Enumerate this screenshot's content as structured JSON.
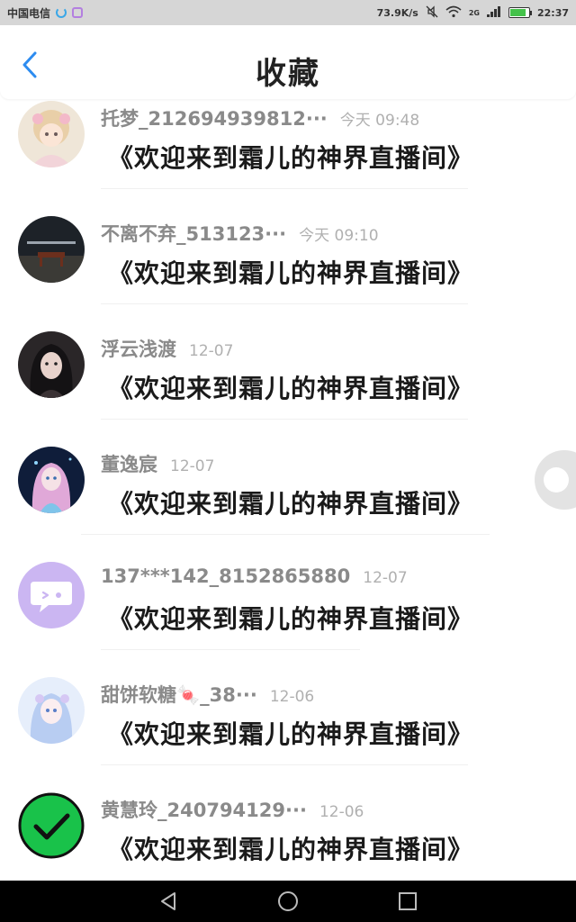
{
  "status_bar": {
    "carrier": "中国电信",
    "speed": "73.9K/s",
    "network": "2G",
    "time": "22:37",
    "battery_level": 0.85
  },
  "header": {
    "title": "收藏",
    "accent_color": "#2d8cf0"
  },
  "favorites": [
    {
      "name": "托梦_212694939812···",
      "time": "今天 09:48",
      "message": "《欢迎来到霜儿的神界直播间》",
      "avatar": "anime-girl-avatar"
    },
    {
      "name": "不离不弃_513123···",
      "time": "今天 09:10",
      "message": "《欢迎来到霜儿的神界直播间》",
      "avatar": "bench-photo-avatar"
    },
    {
      "name": "浮云浅渡",
      "time": "12-07",
      "message": "《欢迎来到霜儿的神界直播间》",
      "avatar": "dark-hair-girl-avatar"
    },
    {
      "name": "董逸宸",
      "time": "12-07",
      "message": "《欢迎来到霜儿的神界直播间》",
      "avatar": "fantasy-girl-avatar"
    },
    {
      "name": "137***142_8152865880",
      "time": "12-07",
      "message": "《欢迎来到霜儿的神界直播间》",
      "avatar": "chat-bubble-avatar"
    },
    {
      "name": "甜饼软糖🍬_38···",
      "time": "12-06",
      "message": "《欢迎来到霜儿的神界直播间》",
      "avatar": "anime-blue-girl-avatar"
    },
    {
      "name": "黄慧玲_240794129···",
      "time": "12-06",
      "message": "《欢迎来到霜儿的神界直播间》",
      "avatar": "green-check-avatar"
    }
  ]
}
